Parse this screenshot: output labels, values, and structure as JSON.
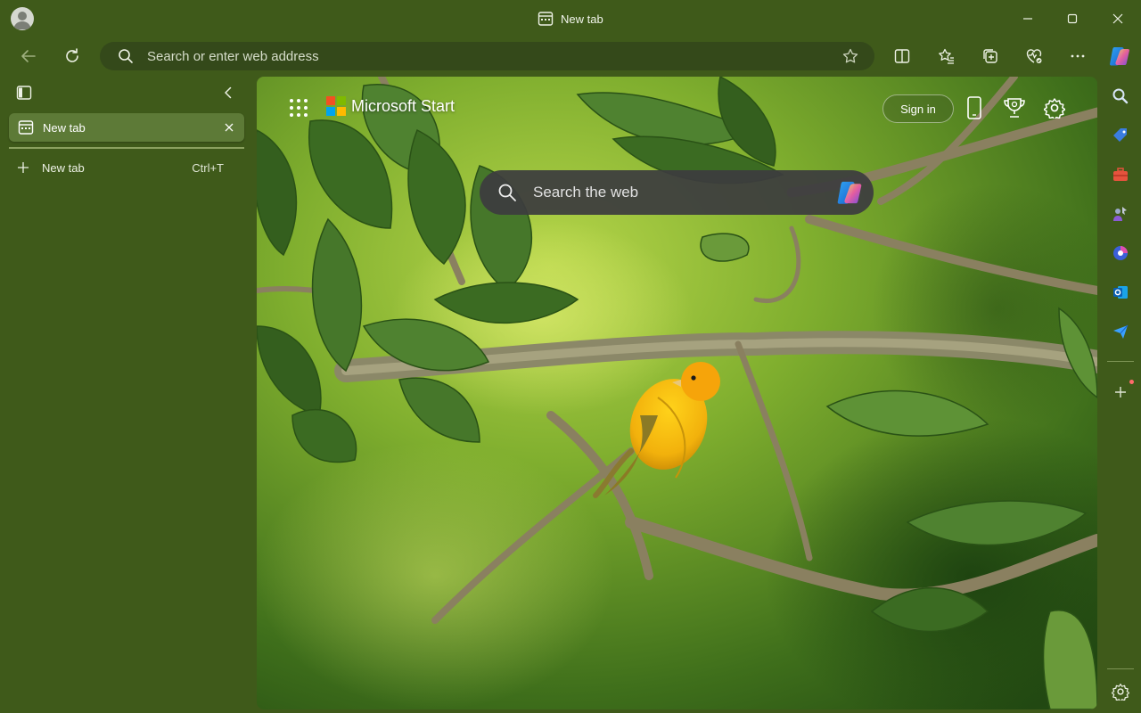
{
  "window": {
    "title": "New tab",
    "minimize_icon": "minimize-icon",
    "maximize_icon": "maximize-icon",
    "close_icon": "close-icon"
  },
  "toolbar": {
    "address_placeholder": "Search or enter web address",
    "icons": [
      "back-icon",
      "refresh-icon",
      "search-icon",
      "favorite-star-icon",
      "split-screen-icon",
      "favorites-icon",
      "collections-icon",
      "browser-essentials-icon",
      "more-icon",
      "copilot-icon"
    ]
  },
  "vertical_tabs": {
    "tabs": [
      {
        "label": "New tab"
      }
    ],
    "new_tab_label": "New tab",
    "new_tab_shortcut": "Ctrl+T"
  },
  "start_page": {
    "brand": "Microsoft Start",
    "search_placeholder": "Search the web",
    "sign_in_label": "Sign in"
  },
  "right_rail": {
    "icons": [
      "search-icon",
      "shopping-tag-icon",
      "tools-icon",
      "games-icon",
      "copilot-designer-icon",
      "outlook-icon",
      "send-icon",
      "add-icon",
      "settings-icon"
    ]
  },
  "colors": {
    "frame": "#3f5a1a",
    "active_tab": "#5d7a37",
    "search_pill": "#3c3c3e"
  }
}
